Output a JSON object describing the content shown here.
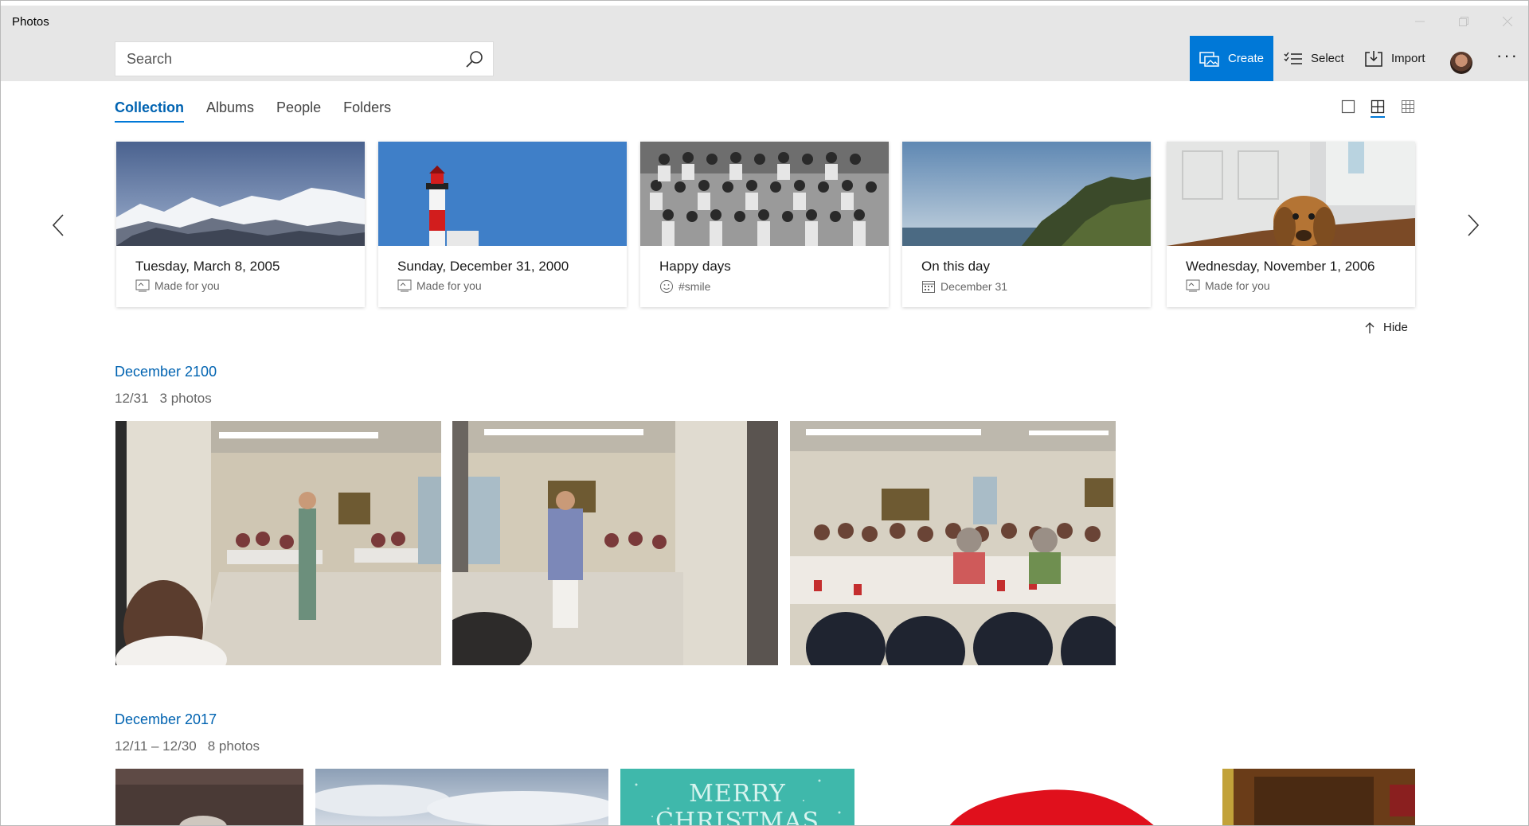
{
  "window": {
    "title": "Photos"
  },
  "search": {
    "placeholder": "Search"
  },
  "toolbar": {
    "create_label": "Create",
    "select_label": "Select",
    "import_label": "Import",
    "more_label": "···"
  },
  "tabs": [
    {
      "label": "Collection",
      "active": true
    },
    {
      "label": "Albums",
      "active": false
    },
    {
      "label": "People",
      "active": false
    },
    {
      "label": "Folders",
      "active": false
    }
  ],
  "view_sizes": [
    "single-view-icon",
    "medium-grid-icon",
    "small-grid-icon"
  ],
  "carousel": {
    "cards": [
      {
        "title": "Tuesday, March 8, 2005",
        "subtitle": "Made for you",
        "icon": "album-icon"
      },
      {
        "title": "Sunday, December 31, 2000",
        "subtitle": "Made for you",
        "icon": "album-icon"
      },
      {
        "title": "Happy days",
        "subtitle": "#smile",
        "icon": "smile-icon"
      },
      {
        "title": "On this day",
        "subtitle": "December 31",
        "icon": "calendar-icon"
      },
      {
        "title": "Wednesday, November 1, 2006",
        "subtitle": "Made for you",
        "icon": "album-icon"
      }
    ],
    "hide_label": "Hide"
  },
  "groups": [
    {
      "title": "December 2100",
      "dates": "12/31",
      "count": "3 photos"
    },
    {
      "title": "December 2017",
      "dates": "12/11 – 12/30",
      "count": "8 photos"
    }
  ],
  "christmas_card_text": "MERRY CHRISTMAS",
  "colors": {
    "accent": "#0078d7",
    "link": "#0063b1",
    "titlebar": "#e6e6e6"
  }
}
